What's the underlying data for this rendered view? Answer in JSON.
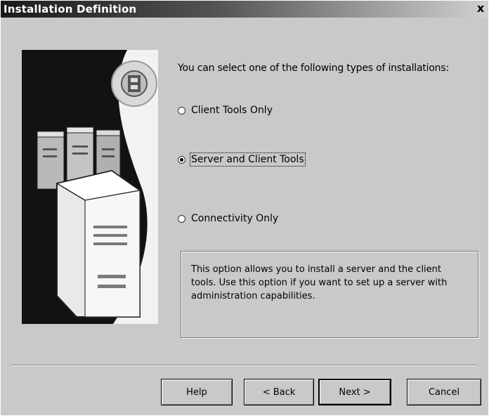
{
  "window": {
    "title": "Installation Definition",
    "close_symbol": "x"
  },
  "intro": "You can select one of the following types of installations:",
  "options": [
    {
      "label": "Client Tools Only",
      "selected": false
    },
    {
      "label": "Server and Client Tools",
      "selected": true
    },
    {
      "label": "Connectivity Only",
      "selected": false
    }
  ],
  "description": "This option allows you to install a server and the client tools. Use this option if you want to set up a server with administration capabilities.",
  "buttons": {
    "help": "Help",
    "back": "< Back",
    "next": "Next >",
    "cancel": "Cancel"
  }
}
